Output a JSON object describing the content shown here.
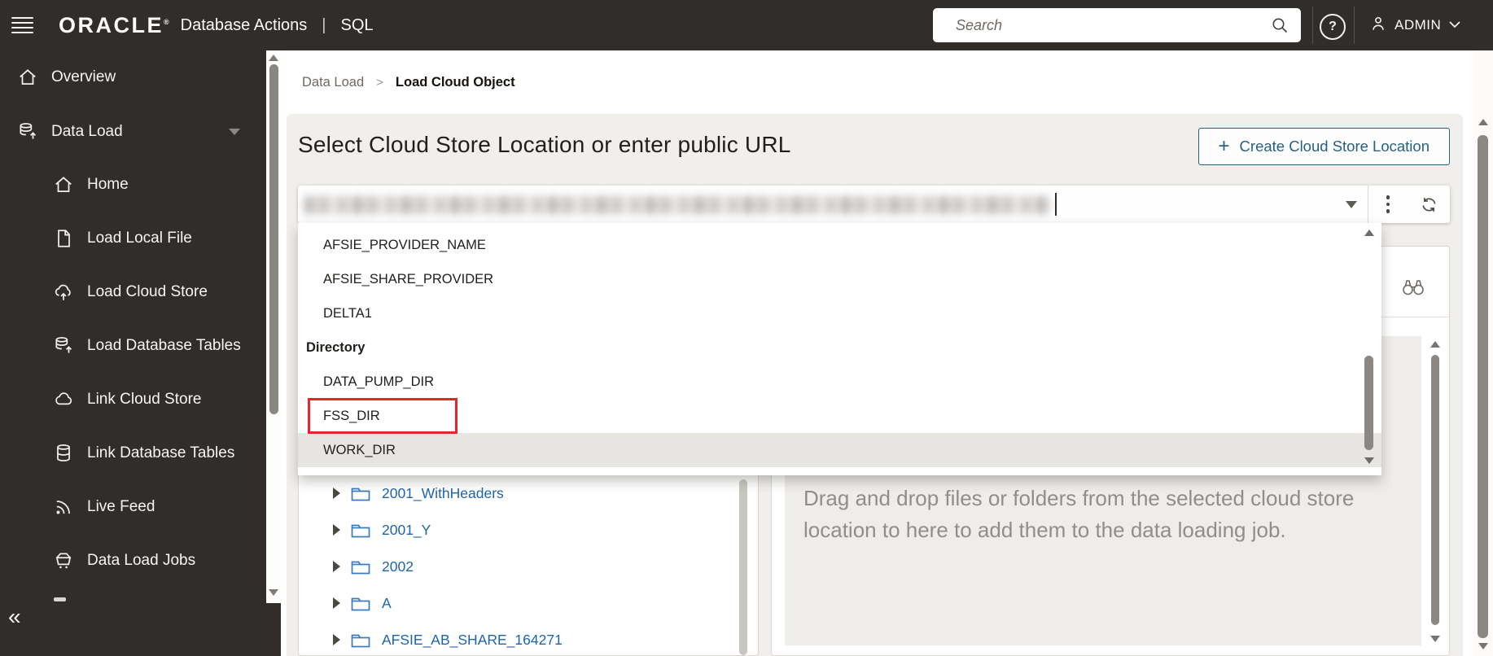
{
  "topbar": {
    "brand": "ORACLE",
    "brand_reg": "®",
    "product": "Database Actions",
    "separator": "|",
    "context": "SQL",
    "search_placeholder": "Search",
    "help_label": "?",
    "user": "ADMIN"
  },
  "sidebar": {
    "items": [
      {
        "label": "Overview",
        "icon": "home",
        "level": 0
      },
      {
        "label": "Data Load",
        "icon": "database-upload",
        "level": 0,
        "expanded": true
      },
      {
        "label": "Home",
        "icon": "home",
        "level": 1
      },
      {
        "label": "Load Local File",
        "icon": "file",
        "level": 1
      },
      {
        "label": "Load Cloud Store",
        "icon": "cloud-upload",
        "level": 1
      },
      {
        "label": "Load Database Tables",
        "icon": "database-upload",
        "level": 1
      },
      {
        "label": "Link Cloud Store",
        "icon": "cloud",
        "level": 1
      },
      {
        "label": "Link Database Tables",
        "icon": "database",
        "level": 1
      },
      {
        "label": "Live Feed",
        "icon": "live-feed",
        "level": 1
      },
      {
        "label": "Data Load Jobs",
        "icon": "cart",
        "level": 1
      }
    ],
    "collapse_glyph": "«"
  },
  "breadcrumb": {
    "parent": "Data Load",
    "separator": ">",
    "current": "Load Cloud Object"
  },
  "main": {
    "title": "Select Cloud Store Location or enter public URL",
    "create_button_plus": "+",
    "create_button": "Create Cloud Store Location",
    "combobox": {
      "value_obscured": true,
      "caret_visible": true
    }
  },
  "dropdown": {
    "items": [
      {
        "label": "AFSIE_PROVIDER_NAME",
        "type": "item"
      },
      {
        "label": "AFSIE_SHARE_PROVIDER",
        "type": "item"
      },
      {
        "label": "DELTA1",
        "type": "item"
      },
      {
        "label": "Directory",
        "type": "group"
      },
      {
        "label": "DATA_PUMP_DIR",
        "type": "item"
      },
      {
        "label": "FSS_DIR",
        "type": "item",
        "annotated": true
      },
      {
        "label": "WORK_DIR",
        "type": "item",
        "hovered": true
      }
    ],
    "annotation_color": "#e8252b"
  },
  "tree": {
    "folders": [
      {
        "label": "2001_WithHeaders"
      },
      {
        "label": "2001_Y"
      },
      {
        "label": "2002"
      },
      {
        "label": "A"
      },
      {
        "label": "AFSIE_AB_SHARE_164271"
      }
    ]
  },
  "dropzone": {
    "message": "Drag and drop files or folders from the selected cloud store location to here to add them to the data loading job."
  },
  "colors": {
    "topbar_bg": "#312d2a",
    "card_bg": "#f1efec",
    "accent_blue": "#27617f",
    "folder_link_blue": "#1e64ad",
    "annotation_red": "#e8252b",
    "hover_row_gray": "#e7e5e2"
  }
}
